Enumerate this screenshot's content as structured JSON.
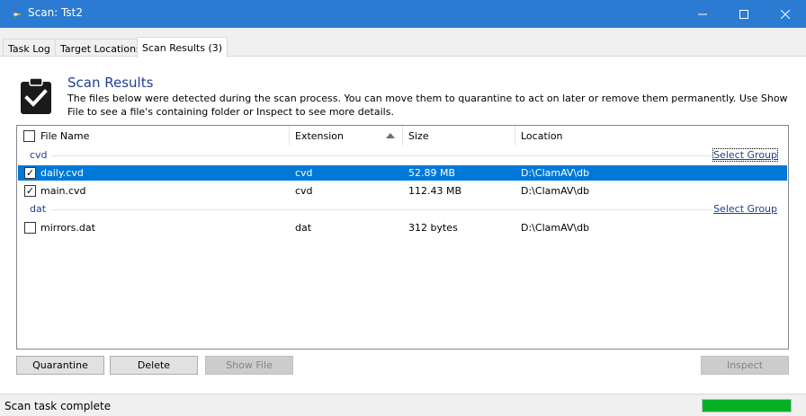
{
  "window": {
    "title": "Scan: Tst2"
  },
  "tabs": [
    {
      "label": "Task Log"
    },
    {
      "label": "Target Locations"
    },
    {
      "label": "Scan Results (3)"
    }
  ],
  "header": {
    "title": "Scan Results",
    "description": "The files below were detected during the scan process. You can move them to quarantine to act on later or remove them permanently. Use Show File to see a file's containing folder or Inspect to see more details."
  },
  "columns": [
    "File Name",
    "Extension",
    "Size",
    "Location"
  ],
  "groups": [
    {
      "name": "cvd",
      "select_label": "Select Group",
      "rows": [
        {
          "checked": true,
          "file": "daily.cvd",
          "ext": "cvd",
          "size": "52.89 MB",
          "location": "D:\\ClamAV\\db",
          "selected": true
        },
        {
          "checked": true,
          "file": "main.cvd",
          "ext": "cvd",
          "size": "112.43 MB",
          "location": "D:\\ClamAV\\db",
          "selected": false
        }
      ]
    },
    {
      "name": "dat",
      "select_label": "Select Group",
      "rows": [
        {
          "checked": false,
          "file": "mirrors.dat",
          "ext": "dat",
          "size": "312 bytes",
          "location": "D:\\ClamAV\\db",
          "selected": false
        }
      ]
    }
  ],
  "buttons": {
    "quarantine": "Quarantine",
    "delete": "Delete",
    "show_file": "Show File",
    "inspect": "Inspect"
  },
  "status": {
    "text": "Scan task complete",
    "progress": 1.0
  },
  "colors": {
    "titlebar": "#2b7bd3",
    "selection": "#0078d7",
    "progress": "#06b025",
    "link": "#1f3f8f"
  }
}
